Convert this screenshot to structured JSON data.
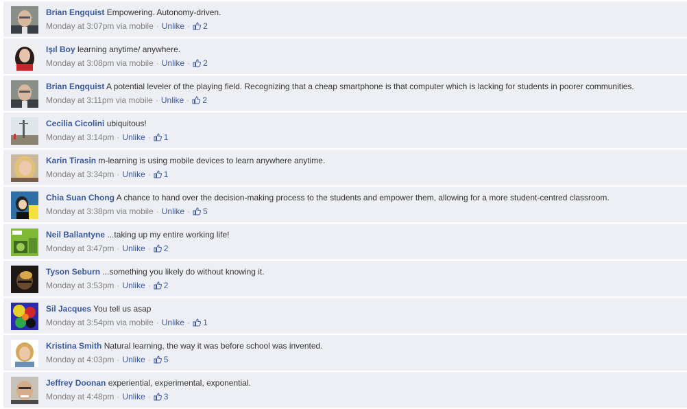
{
  "unlike_label": "Unlike",
  "comments": [
    {
      "author": "Brian Engquist",
      "text": "Empowering. Autonomy-driven.",
      "time": "Monday at 3:07pm via mobile",
      "likes": "2",
      "avatar": "man-grey"
    },
    {
      "author": "Işıl Boy",
      "text": "learning anytime/ anywhere.",
      "time": "Monday at 3:08pm via mobile",
      "likes": "2",
      "avatar": "woman-red"
    },
    {
      "author": "Brian Engquist",
      "text": "A potential leveler of the playing field. Recognizing that a cheap smartphone is that computer which is lacking for students in poorer communities.",
      "time": "Monday at 3:11pm via mobile",
      "likes": "2",
      "avatar": "man-grey"
    },
    {
      "author": "Cecilia Cicolini",
      "text": "ubiquitous!",
      "time": "Monday at 3:14pm",
      "likes": "1",
      "avatar": "landscape"
    },
    {
      "author": "Karin Tirasin",
      "text": "m-learning is using mobile devices to learn anywhere anytime.",
      "time": "Monday at 3:34pm",
      "likes": "1",
      "avatar": "woman-blonde"
    },
    {
      "author": "Chia Suan Chong",
      "text": "A chance to hand over the decision-making process to the students and empower them, allowing for a more student-centred classroom.",
      "time": "Monday at 3:38pm via mobile",
      "likes": "5",
      "avatar": "cartoon"
    },
    {
      "author": "Neil Ballantyne",
      "text": "...taking up my entire working life!",
      "time": "Monday at 3:47pm",
      "likes": "2",
      "avatar": "green-logo"
    },
    {
      "author": "Tyson Seburn",
      "text": "...something you likely do without knowing it.",
      "time": "Monday at 3:53pm",
      "likes": "2",
      "avatar": "dark-face"
    },
    {
      "author": "Sil Jacques",
      "text": "You tell us asap",
      "time": "Monday at 3:54pm via mobile",
      "likes": "1",
      "avatar": "colorful"
    },
    {
      "author": "Kristina Smith",
      "text": "Natural learning, the way it was before school was invented.",
      "time": "Monday at 4:03pm",
      "likes": "5",
      "avatar": "woman-light"
    },
    {
      "author": "Jeffrey Doonan",
      "text": "experiential, experimental, exponential.",
      "time": "Monday at 4:48pm",
      "likes": "3",
      "avatar": "man-smile"
    }
  ]
}
